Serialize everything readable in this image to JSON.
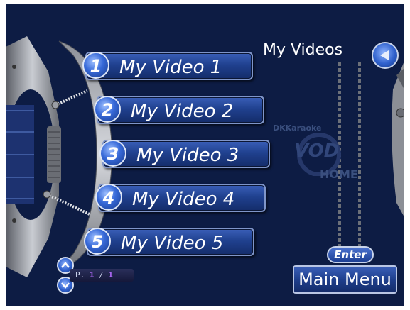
{
  "header": {
    "title": "My Videos"
  },
  "menu": {
    "items": [
      {
        "number": "1",
        "label": "My Video 1"
      },
      {
        "number": "2",
        "label": "My Video 2"
      },
      {
        "number": "3",
        "label": "My Video 3"
      },
      {
        "number": "4",
        "label": "My Video 4"
      },
      {
        "number": "5",
        "label": "My Video 5"
      }
    ]
  },
  "pager": {
    "prefix": "P.",
    "current": "1",
    "separator": "/",
    "total": "1"
  },
  "footer": {
    "enter_label": "Enter",
    "main_menu_label": "Main Menu"
  },
  "logo": {
    "small_text": "DKKaraoke",
    "big_text": "VOD",
    "sub_text": "HOME"
  },
  "colors": {
    "background": "#0d1c44",
    "button_fill": "#20418f",
    "accent": "#b66cff"
  },
  "icons": {
    "back": "back-arrow-icon",
    "page_up": "chevron-up-icon",
    "page_down": "chevron-down-icon"
  }
}
